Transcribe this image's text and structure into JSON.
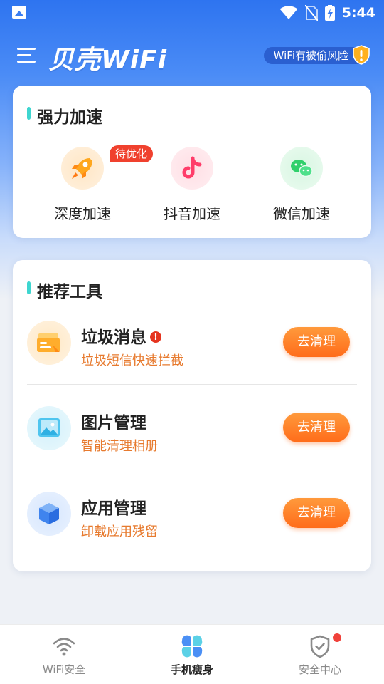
{
  "status_bar": {
    "time": "5:44"
  },
  "header": {
    "app_title": "贝壳WiFi",
    "risk_label": "WiFi有被偷风险"
  },
  "boost_card": {
    "title": "强力加速",
    "items": [
      {
        "label": "深度加速",
        "icon": "rocket-icon",
        "badge": "待优化"
      },
      {
        "label": "抖音加速",
        "icon": "douyin-icon"
      },
      {
        "label": "微信加速",
        "icon": "wechat-icon"
      }
    ]
  },
  "tools_card": {
    "title": "推荐工具",
    "items": [
      {
        "title": "垃圾消息",
        "desc": "垃圾短信快速拦截",
        "button": "去清理",
        "icon": "message-box-icon",
        "warning": "!"
      },
      {
        "title": "图片管理",
        "desc": "智能清理相册",
        "button": "去清理",
        "icon": "picture-icon"
      },
      {
        "title": "应用管理",
        "desc": "卸载应用残留",
        "button": "去清理",
        "icon": "cube-icon"
      }
    ]
  },
  "tab_bar": {
    "tabs": [
      {
        "label": "WiFi安全",
        "icon": "wifi-icon",
        "active": false
      },
      {
        "label": "手机瘦身",
        "icon": "clover-icon",
        "active": true
      },
      {
        "label": "安全中心",
        "icon": "shield-check-icon",
        "active": false
      }
    ]
  },
  "colors": {
    "accent_orange": "#ff7a22",
    "brand_blue": "#2e74f0",
    "desc_orange": "#e77a2e",
    "badge_red": "#f0412e"
  }
}
